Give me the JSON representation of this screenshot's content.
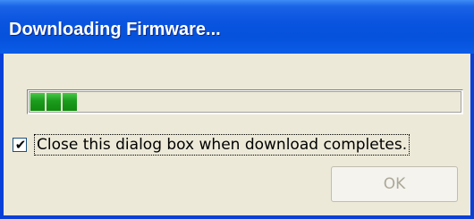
{
  "window": {
    "title": "Downloading Firmware..."
  },
  "progress": {
    "segments_filled": 3,
    "fill_color": "#1c9c1c"
  },
  "close_on_complete": {
    "checked": true,
    "check_glyph": "✔",
    "label": "Close this dialog box when download completes."
  },
  "ok_button": {
    "label": "OK",
    "enabled": false
  },
  "colors": {
    "titlebar": "#0552dc",
    "window_frame": "#0840d8",
    "dialog_bg": "#ece9d8"
  }
}
